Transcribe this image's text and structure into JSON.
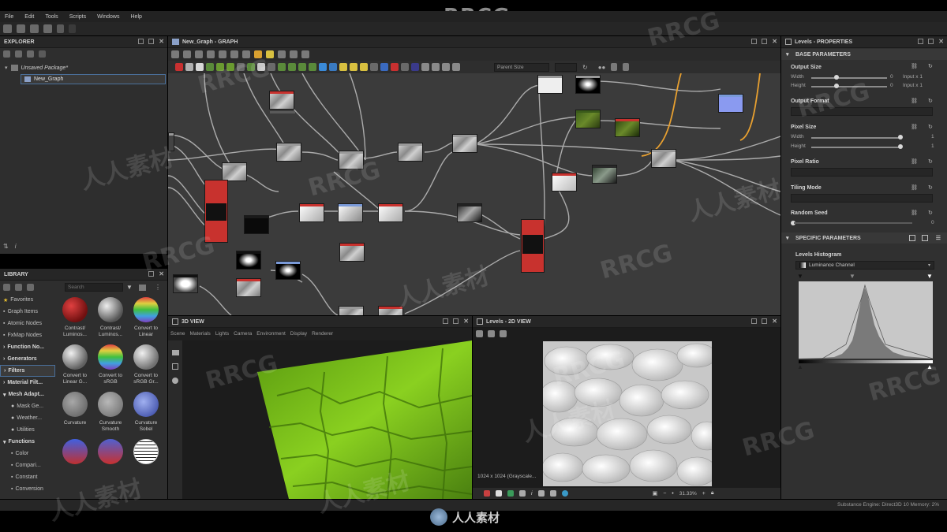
{
  "title_logo": "RRCG",
  "menu": [
    "File",
    "Edit",
    "Tools",
    "Scripts",
    "Windows",
    "Help"
  ],
  "explorer": {
    "title": "EXPLORER",
    "package": "Unsaved Package*",
    "graph_item": "New_Graph"
  },
  "graph": {
    "title": "New_Graph - GRAPH",
    "parent_size_label": "Parent Size"
  },
  "library": {
    "title": "LIBRARY",
    "search_placeholder": "Search",
    "categories": [
      {
        "label": "Favorites",
        "icon": "star-icon"
      },
      {
        "label": "Graph Items",
        "icon": "graph-icon"
      },
      {
        "label": "Atomic Nodes",
        "icon": "atomic-icon"
      },
      {
        "label": "FxMap Nodes",
        "icon": "fxmap-icon"
      },
      {
        "label": "Function No...",
        "icon": "function-icon",
        "bold": true
      },
      {
        "label": "Generators",
        "bold": true
      },
      {
        "label": "Filters",
        "bold": true,
        "selected": true
      },
      {
        "label": "Material Filt...",
        "bold": true
      },
      {
        "label": "Mesh Adapt...",
        "bold": true
      },
      {
        "label": "Mask Ge..."
      },
      {
        "label": "Weather..."
      },
      {
        "label": "Utilities"
      },
      {
        "label": "Functions",
        "bold": true
      },
      {
        "label": "Color"
      },
      {
        "label": "Compari..."
      },
      {
        "label": "Constant"
      },
      {
        "label": "Conversion"
      }
    ],
    "thumbs": [
      {
        "label": "Contrast/ Luminos...",
        "color": "#b01818"
      },
      {
        "label": "Contrast/ Luminos...",
        "color": "#9a9a9a"
      },
      {
        "label": "Convert to Linear",
        "color": "#3aa8d8"
      },
      {
        "label": "Convert to Linear G...",
        "color": "#bdbdbd"
      },
      {
        "label": "Convert to sRGB",
        "color": "#5ac85a"
      },
      {
        "label": "Convert to sRGB Gr...",
        "color": "#c8c8c8"
      },
      {
        "label": "Curvature",
        "color": "#9a9a9a"
      },
      {
        "label": "Curvature Smooth",
        "color": "#a8a8a8"
      },
      {
        "label": "Curvature Sobel",
        "color": "#7a8ad8"
      },
      {
        "label": "",
        "color": "#3050c0"
      },
      {
        "label": "",
        "color": "#c03030"
      },
      {
        "label": "",
        "color": "#f0f0f0"
      }
    ]
  },
  "view3d": {
    "title": "3D VIEW",
    "tabs": [
      "Scene",
      "Materials",
      "Lights",
      "Camera",
      "Environment",
      "Display",
      "Renderer"
    ]
  },
  "view2d": {
    "title": "Levels - 2D VIEW",
    "resolution": "1024 x 1024 (Grayscale...",
    "zoom": "31.33%"
  },
  "properties": {
    "title": "Levels - PROPERTIES",
    "base_section": "BASE PARAMETERS",
    "output_size": "Output Size",
    "width_label": "Width",
    "height_label": "Height",
    "width_value": "0",
    "height_value": "0",
    "width_mode": "Input x 1",
    "height_mode": "Input x 1",
    "output_format": "Output Format",
    "pixel_size": "Pixel Size",
    "px_width_label": "Width",
    "px_height_label": "Height",
    "px_width_value": "1",
    "px_height_value": "1",
    "pixel_ratio": "Pixel Ratio",
    "tiling_mode": "Tiling Mode",
    "random_seed": "Random Seed",
    "random_seed_value": "0",
    "specific_section": "SPECIFIC PARAMETERS",
    "levels_histogram": "Levels Histogram",
    "channel": "Luminance Channel"
  },
  "status": {
    "engine": "Substance Engine: Direct3D 10  Memory: 2%"
  },
  "watermark_text": "RRCG",
  "watermark_cn": "人人素材",
  "footer_logo": "人人素材",
  "colors": {
    "accent": "#4a6f9a",
    "node_red": "#c8322e",
    "node_blue": "#7a8ad8",
    "wire_orange": "#e8a030",
    "grass": "#7cc020"
  }
}
